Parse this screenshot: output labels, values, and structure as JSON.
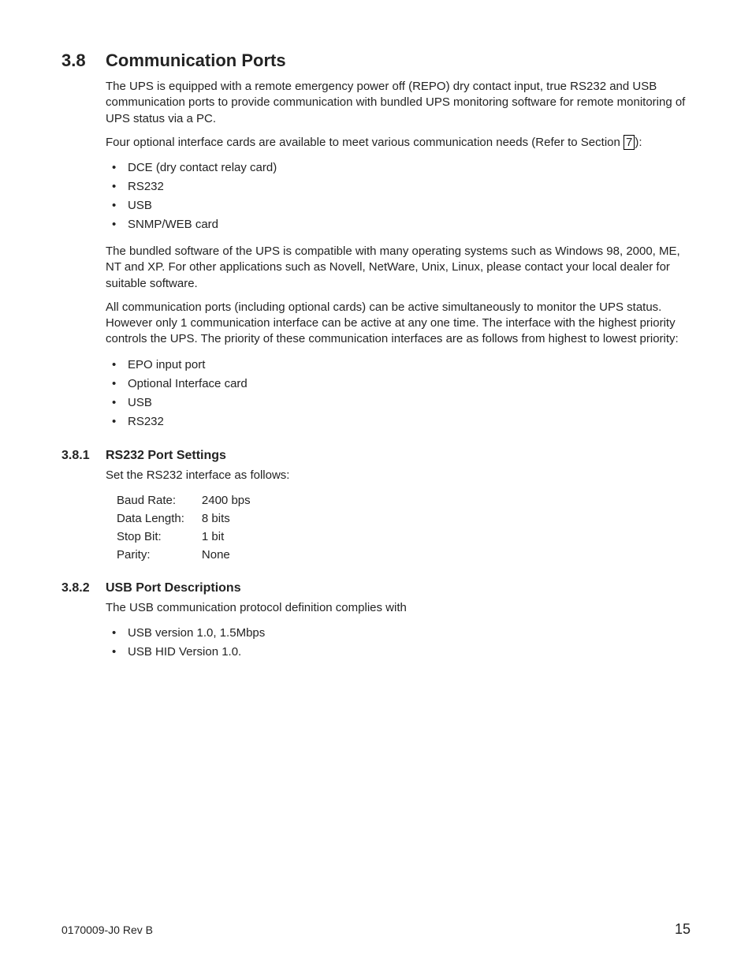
{
  "section": {
    "number": "3.8",
    "title": "Communication Ports",
    "para1": "The UPS is equipped with a remote emergency power off (REPO) dry contact input, true RS232 and USB communication ports to provide communication with bundled UPS monitoring software for remote monitoring of UPS status via a PC.",
    "para2_pre": "Four optional interface cards are available to meet various communication needs (Refer to Section ",
    "para2_ref": "7",
    "para2_post": "):",
    "list1": [
      "DCE (dry contact relay card)",
      "RS232",
      "USB",
      "SNMP/WEB card"
    ],
    "para3": "The bundled software of the UPS is compatible with many operating systems such as Windows 98, 2000, ME, NT and XP.  For other applications such as Novell, NetWare, Unix, Linux, please contact your local dealer for suitable software.",
    "para4": "All communication ports (including optional cards) can be active simultaneously to monitor the UPS status. However only 1 communication interface can be active at any one time. The interface with the highest priority controls the UPS. The priority of these communication interfaces are as follows from highest to lowest priority:",
    "list2": [
      "EPO input port",
      "Optional Interface card",
      "USB",
      "RS232"
    ]
  },
  "sub1": {
    "number": "3.8.1",
    "title": "RS232 Port Settings",
    "intro": "Set the RS232 interface as follows:",
    "rows": [
      {
        "label": "Baud Rate:",
        "value": "2400 bps"
      },
      {
        "label": "Data Length:",
        "value": "8 bits"
      },
      {
        "label": "Stop Bit:",
        "value": "1 bit"
      },
      {
        "label": "Parity:",
        "value": "None"
      }
    ]
  },
  "sub2": {
    "number": "3.8.2",
    "title": "USB Port Descriptions",
    "intro": "The USB communication protocol definition complies with",
    "list": [
      "USB version 1.0, 1.5Mbps",
      "USB HID Version 1.0."
    ]
  },
  "footer": {
    "docid": "0170009-J0   Rev B",
    "page": "15"
  }
}
